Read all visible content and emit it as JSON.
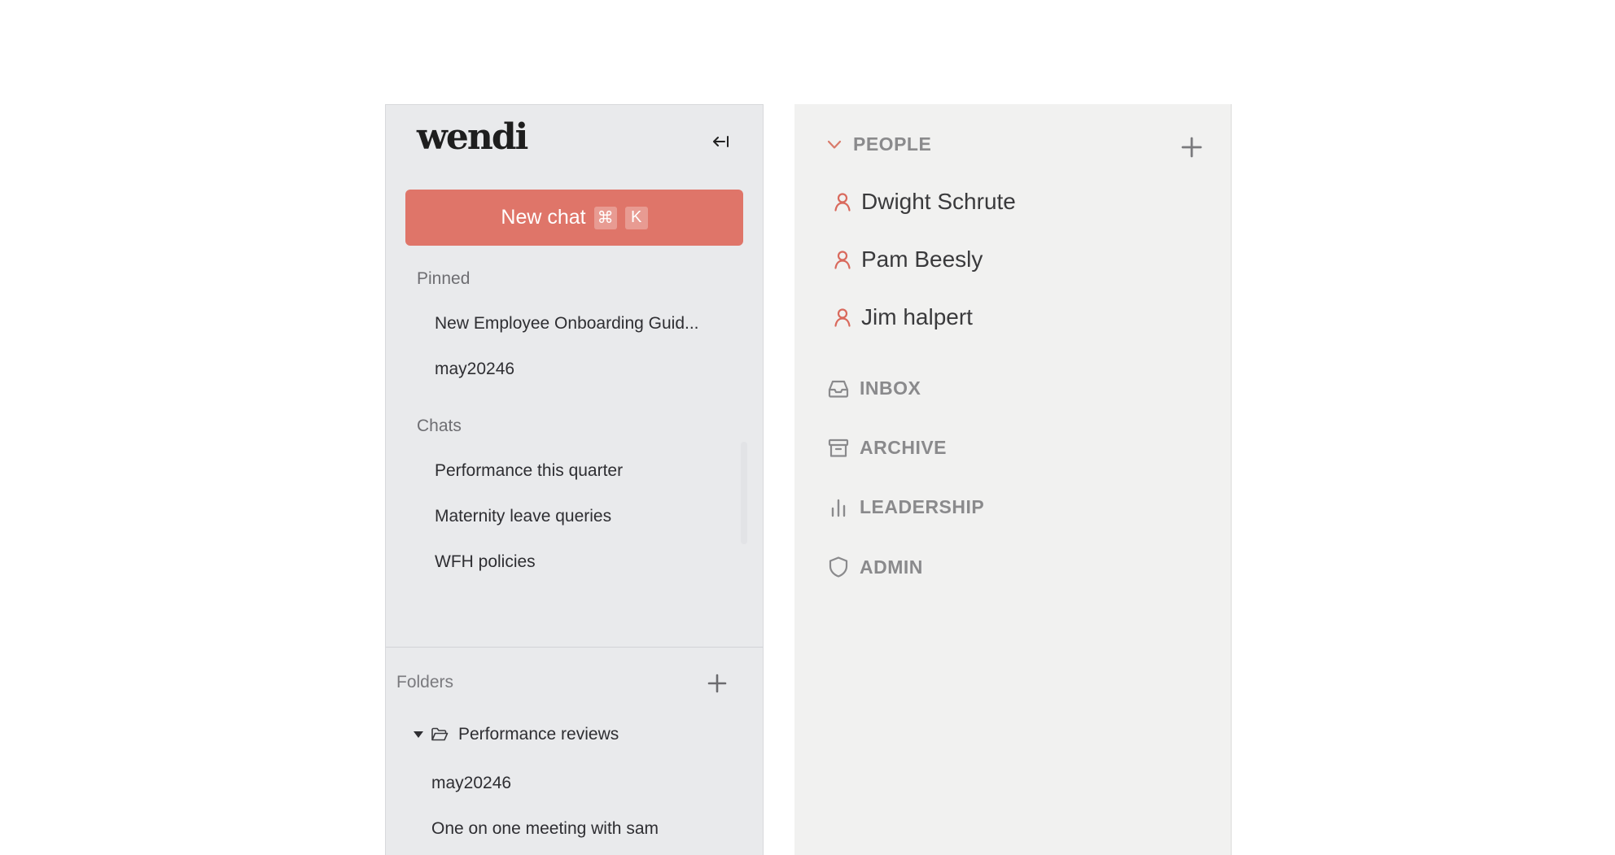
{
  "sidebar": {
    "logo": "wendi",
    "new_chat": {
      "label": "New chat",
      "key1": "⌘",
      "key2": "K"
    },
    "pinned": {
      "label": "Pinned",
      "items": [
        "New Employee Onboarding Guid...",
        "may20246"
      ]
    },
    "chats": {
      "label": "Chats",
      "items": [
        "Performance this quarter",
        "Maternity leave queries",
        "WFH policies"
      ]
    },
    "folders": {
      "label": "Folders",
      "folder_name": "Performance reviews",
      "children": [
        "may20246",
        "One on one meeting with sam"
      ]
    }
  },
  "panel": {
    "people_label": "PEOPLE",
    "people": [
      "Dwight Schrute",
      "Pam Beesly",
      "Jim halpert"
    ],
    "sections": [
      "INBOX",
      "ARCHIVE",
      "LEADERSHIP",
      "ADMIN"
    ]
  },
  "colors": {
    "accent": "#df7569",
    "sidebar_bg": "#e9eaec",
    "panel_bg": "#f1f1f0"
  }
}
